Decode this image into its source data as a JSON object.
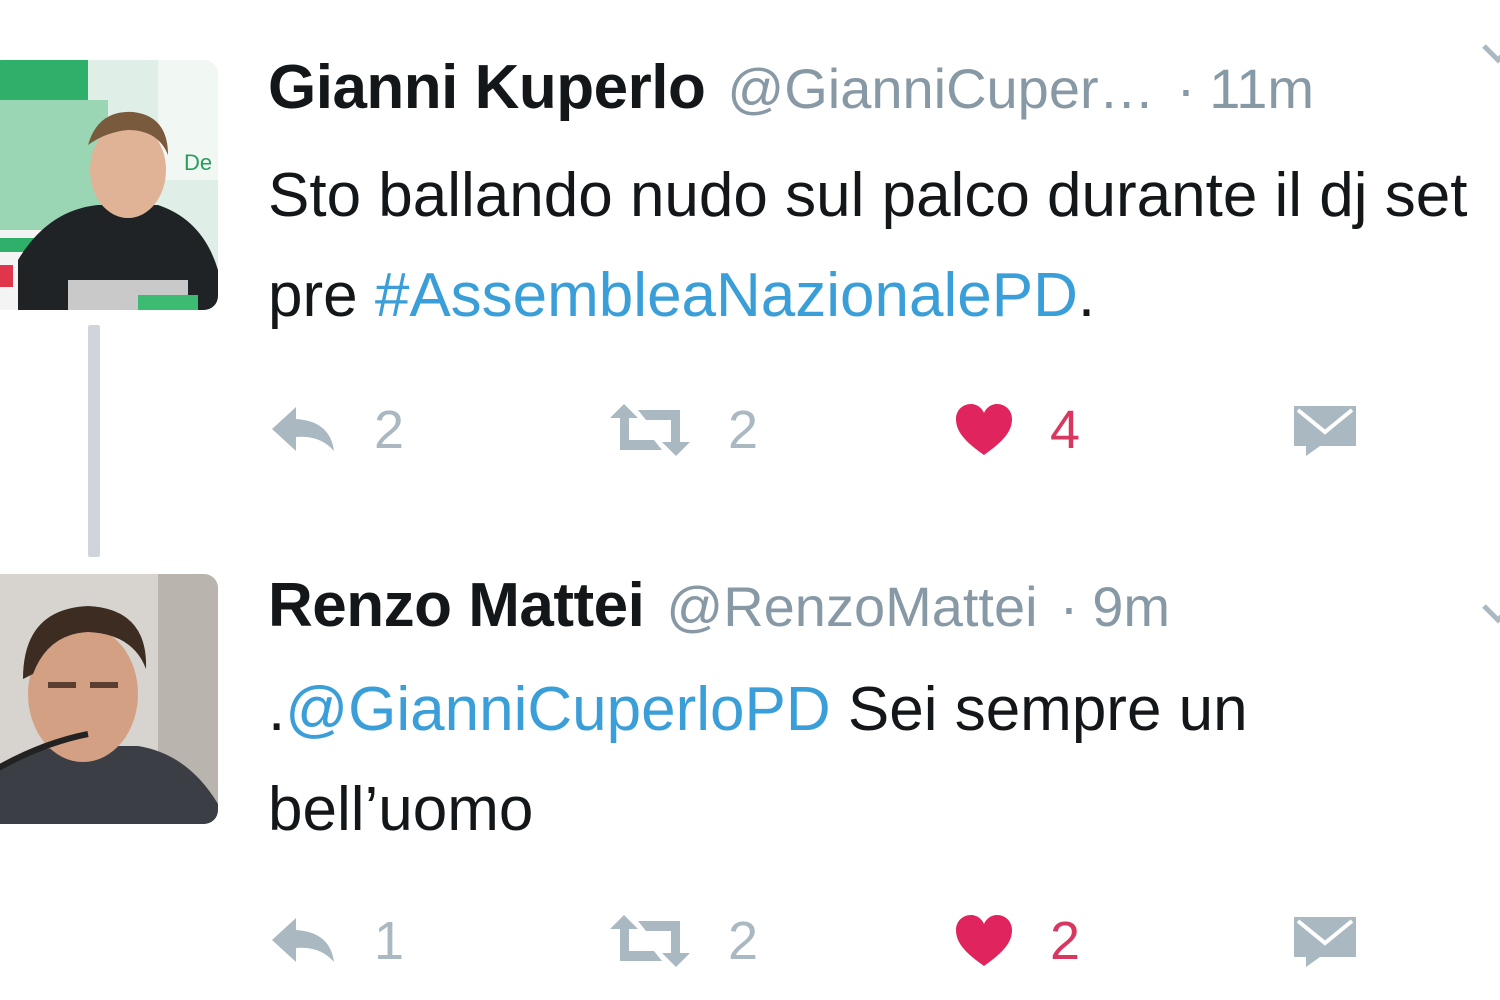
{
  "colors": {
    "name": "#14171a",
    "secondary": "#8899a6",
    "link": "#3a9ed8",
    "action_gray": "#aab8c2",
    "like_red": "#e0245e",
    "thread_line": "#cfd5da"
  },
  "tweets": [
    {
      "name": "Gianni Kuperlo",
      "handle": "@GianniCuper…",
      "separator": "·",
      "time": "11m",
      "text_before": "Sto ballando nudo sul palco durante il dj set pre ",
      "hashtag": "#AssembleaNazionalePD",
      "text_after": ".",
      "reply_count": "2",
      "retweet_count": "2",
      "like_count": "4",
      "avatar_icon": "avatar-photo-man-green-banner"
    },
    {
      "name": "Renzo Mattei",
      "handle": "@RenzoMattei",
      "separator": "·",
      "time": "9m",
      "text_before": ".",
      "mention": "@GianniCuperloPD",
      "text_after": " Sei sempre un bell’uomo",
      "reply_count": "1",
      "retweet_count": "2",
      "like_count": "2",
      "avatar_icon": "avatar-photo-man-microphone"
    }
  ],
  "icons": [
    "reply-icon",
    "retweet-icon",
    "heart-icon",
    "direct-message-icon",
    "chevron-down-icon"
  ]
}
